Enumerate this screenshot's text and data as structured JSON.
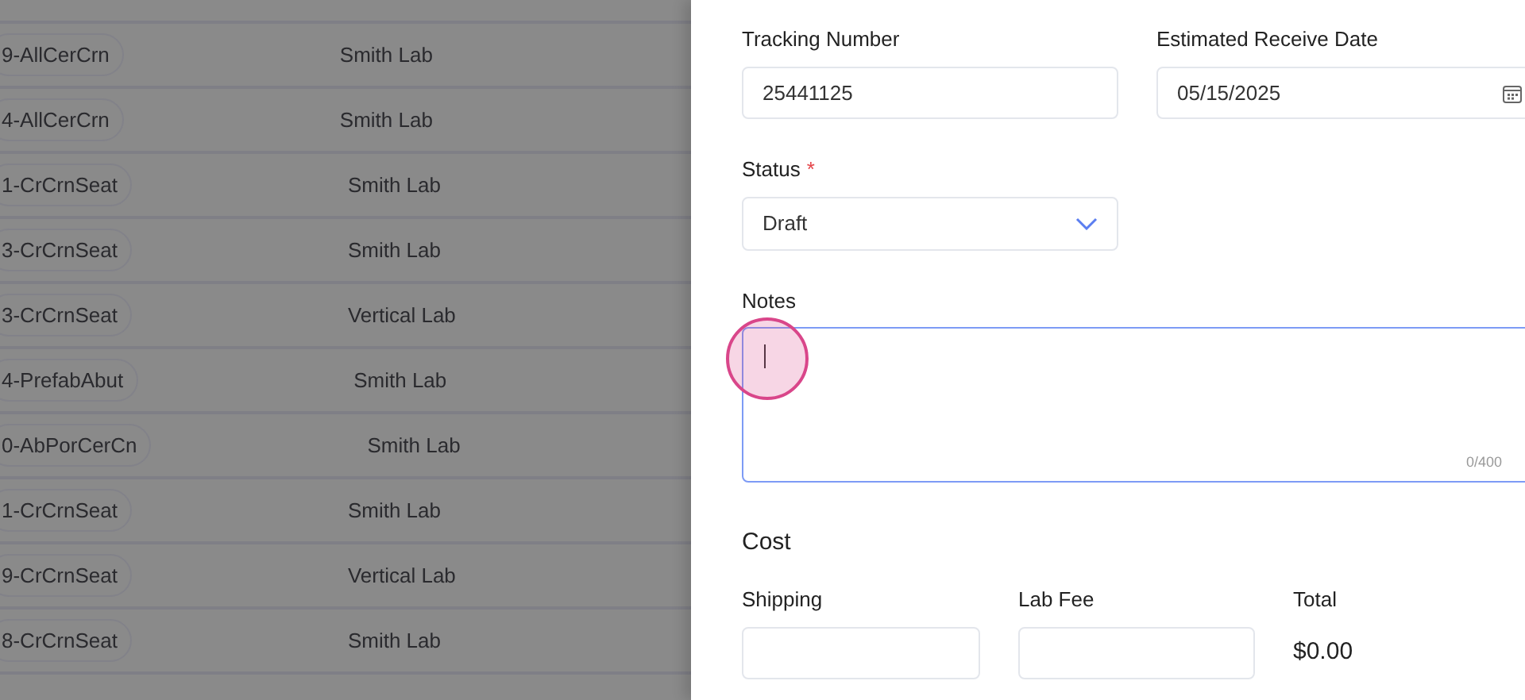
{
  "table": {
    "rows": [
      {
        "code": "9-AllCerCrn",
        "lab": "Smith Lab"
      },
      {
        "code": "4-AllCerCrn",
        "lab": "Smith Lab"
      },
      {
        "code": "1-CrCrnSeat",
        "lab": "Smith Lab"
      },
      {
        "code": "3-CrCrnSeat",
        "lab": "Smith Lab"
      },
      {
        "code": "3-CrCrnSeat",
        "lab": "Vertical Lab"
      },
      {
        "code": "4-PrefabAbut",
        "lab": "Smith Lab"
      },
      {
        "code": "0-AbPorCerCn",
        "lab": "Smith Lab"
      },
      {
        "code": "1-CrCrnSeat",
        "lab": "Smith Lab"
      },
      {
        "code": "9-CrCrnSeat",
        "lab": "Vertical Lab"
      },
      {
        "code": "8-CrCrnSeat",
        "lab": "Smith Lab"
      }
    ]
  },
  "drawer": {
    "tracking_number": {
      "label": "Tracking Number",
      "value": "25441125"
    },
    "estimated_receive_date": {
      "label": "Estimated Receive Date",
      "value": "05/15/2025"
    },
    "status": {
      "label": "Status",
      "required": true,
      "required_mark": "*",
      "value": "Draft"
    },
    "notes": {
      "label": "Notes",
      "focused": true,
      "counter": "0/400"
    },
    "cost": {
      "title": "Cost",
      "shipping": {
        "label": "Shipping"
      },
      "lab_fee": {
        "label": "Lab Fee"
      },
      "total": {
        "label": "Total",
        "value": "$0.00"
      }
    }
  }
}
